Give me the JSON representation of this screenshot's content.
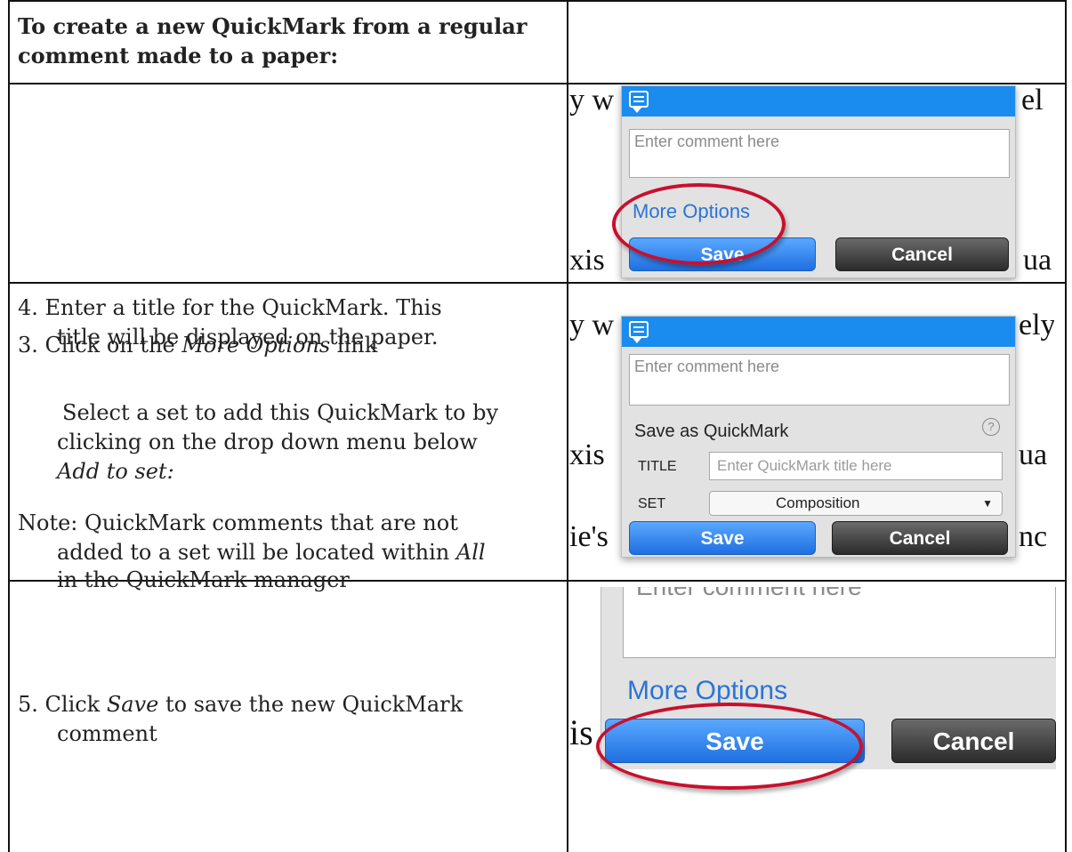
{
  "header": {
    "title": "To create a new QuickMark from a regular comment made to a paper:"
  },
  "steps": [
    {
      "text_prefix": "3. Click on the ",
      "text_italic": "More Options",
      "text_suffix": " link",
      "shot": {
        "doc_left": "y w",
        "doc_right": "el",
        "doc_bottom_left": "xis",
        "doc_bottom_right": "ua",
        "comment_placeholder": "Enter comment here",
        "more_options_label": "More Options",
        "save_label": "Save",
        "cancel_label": "Cancel"
      }
    },
    {
      "line1": "4. Enter a title for the QuickMark. This",
      "line2": "title will be displayed on the paper.",
      "para2_line1": "Select a set to add this QuickMark to by",
      "para2_line2": "clicking on the drop down menu below",
      "para2_italic": "Add to set:",
      "note_line1": "Note: QuickMark comments that are not",
      "note_line2_prefix": "added to a set will be located within ",
      "note_line2_italic": "All",
      "note_line3": "in the QuickMark manager",
      "shot": {
        "doc_left": "y w",
        "doc_right": "ely",
        "doc_mid_left": "xis",
        "doc_mid_right": "ua",
        "doc_bottom_left": "ie's",
        "doc_bottom_right": "nc",
        "comment_placeholder": "Enter comment here",
        "save_as_label": "Save as QuickMark",
        "help_glyph": "?",
        "title_label": "TITLE",
        "title_placeholder": "Enter QuickMark title here",
        "set_label": "SET",
        "set_value": "Composition",
        "save_label": "Save",
        "cancel_label": "Cancel"
      }
    },
    {
      "text_prefix": "5. Click ",
      "text_italic": "Save",
      "text_suffix": " to save the new QuickMark",
      "line2": "comment",
      "shot": {
        "comment_placeholder": "Enter comment here",
        "more_options_label": "More Options",
        "doc_left": "is",
        "save_label": "Save",
        "cancel_label": "Cancel"
      }
    }
  ],
  "colors": {
    "ring": "#c8102e",
    "popup_bar": "#1a8cf0",
    "link": "#2a74d6"
  }
}
